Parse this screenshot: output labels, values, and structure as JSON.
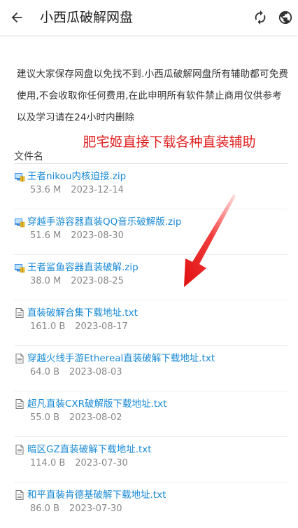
{
  "header": {
    "title": "小西瓜破解网盘",
    "back_icon": "arrow-left-icon",
    "refresh_icon": "refresh-icon",
    "globe_icon": "globe-icon"
  },
  "notice": "建议大家保存网盘以免找不到.小西瓜破解网盘所有辅助都可免费使用,不会收取你任何费用,在此申明所有软件禁止商用仅供参考以及学习请在24小时内删除",
  "promo": "肥宅姬直接下载各种直装辅助",
  "table": {
    "column_header": "文件名"
  },
  "colors": {
    "link": "#1a8ad6",
    "promo": "#e02020",
    "meta": "#888888"
  },
  "files": [
    {
      "name": "王者nikou内核迫接.zip",
      "size": "53.6 M",
      "date": "2023-12-14",
      "type": "zip"
    },
    {
      "name": "穿越手游容器直装QQ音乐破解版.zip",
      "size": "51.6 M",
      "date": "2023-08-30",
      "type": "zip"
    },
    {
      "name": "王者鲨鱼容器直装破解.zip",
      "size": "38.0 M",
      "date": "2023-08-25",
      "type": "zip"
    },
    {
      "name": "直装破解合集下载地址.txt",
      "size": "161.0 B",
      "date": "2023-08-17",
      "type": "txt"
    },
    {
      "name": "穿越火线手游Ethereal直装破解下载地址.txt",
      "size": "64.0 B",
      "date": "2023-08-03",
      "type": "txt"
    },
    {
      "name": "超凡直装CXR破解版下载地址.txt",
      "size": "55.0 B",
      "date": "2023-08-02",
      "type": "txt"
    },
    {
      "name": "暗区GZ直装破解下载地址.txt",
      "size": "114.0 B",
      "date": "2023-07-30",
      "type": "txt"
    },
    {
      "name": "和平直装肯德基破解下载地址.txt",
      "size": "86.0 B",
      "date": "2023-07-30",
      "type": "txt"
    }
  ]
}
